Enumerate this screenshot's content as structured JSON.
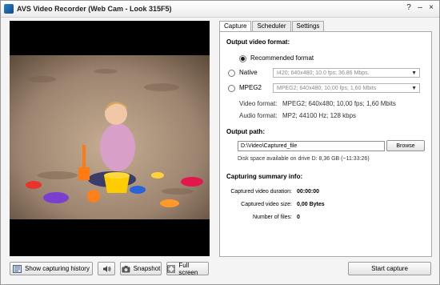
{
  "window": {
    "title": "AVS Video Recorder (Web Cam - Look 315F5)",
    "controls": [
      "?",
      "–",
      "×"
    ]
  },
  "tabs": [
    {
      "label": "Capture",
      "active": true
    },
    {
      "label": "Scheduler",
      "active": false
    },
    {
      "label": "Settings",
      "active": false
    }
  ],
  "output_format": {
    "section_title": "Output video format:",
    "recommended_label": "Recommended format",
    "native_label": "Native",
    "native_value": "I420; 640x480; 10.0 fps; 36.86 Mbps.",
    "mpeg2_label": "MPEG2",
    "mpeg2_value": "MPEG2; 640x480; 10,00 fps; 1,60 Mbits",
    "video_format_label": "Video format:",
    "video_format_value": "MPEG2; 640x480; 10,00 fps; 1,60 Mbits",
    "audio_format_label": "Audio format:",
    "audio_format_value": "MP2; 44100 Hz; 128 kbps",
    "selected": "recommended"
  },
  "output_path": {
    "section_title": "Output path:",
    "value": "D:\\Video\\Captured_file",
    "browse_label": "Browse",
    "disk_space": "Disk space available on drive D: 8,36 GB (~11:33:26)"
  },
  "summary": {
    "section_title": "Capturing summary info:",
    "duration_label": "Captured video duration:",
    "duration_value": "00:00:00",
    "size_label": "Captured video size:",
    "size_value": "0,00 Bytes",
    "files_label": "Number of files:",
    "files_value": "0"
  },
  "bottom_bar": {
    "history_label": "Show capturing history",
    "snapshot_label": "Snapshot",
    "fullscreen_label": "Full screen",
    "start_label": "Start capture"
  }
}
